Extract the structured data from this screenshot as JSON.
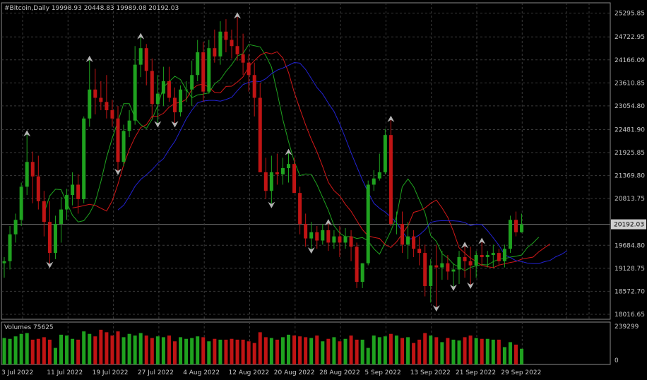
{
  "chart_data": {
    "type": "candlestick",
    "title": "#Bitcoin,Daily  19998.93 20448.83 19989.08 20192.03",
    "volume_label": "Volumes 75625",
    "last_price": "20192.03",
    "price_ticks": [
      "25295.85",
      "24722.95",
      "24166.09",
      "23610.85",
      "23054.80",
      "22481.90",
      "21925.85",
      "21369.80",
      "20813.75",
      "20192.03",
      "19684.80",
      "19128.75",
      "18572.70",
      "18016.65"
    ],
    "volume_ticks": [
      "239299",
      "0"
    ],
    "date_labels": [
      "3 Jul 2022",
      "11 Jul 2022",
      "19 Jul 2022",
      "27 Jul 2022",
      "4 Aug 2022",
      "12 Aug 2022",
      "20 Aug 2022",
      "28 Aug 2022",
      "5 Sep 2022",
      "13 Sep 2022",
      "21 Sep 2022",
      "29 Sep 2022"
    ],
    "grid": true,
    "colors": {
      "background": "#000000",
      "grid": "#3a3a3a",
      "bull": "#1fa21f",
      "bear": "#c01414",
      "ma_fast": "#1fa21f",
      "ma_mid": "#d01818",
      "ma_slow": "#2222d0",
      "fractal": "#b4b4b4",
      "text": "#c8c8c8"
    },
    "ohlc": [
      [
        19250,
        19400,
        18900,
        19300
      ],
      [
        19300,
        20150,
        19100,
        19950
      ],
      [
        19950,
        20450,
        19750,
        20300
      ],
      [
        20300,
        21200,
        20150,
        21100
      ],
      [
        21100,
        22400,
        20900,
        21700
      ],
      [
        21700,
        21950,
        20700,
        21350
      ],
      [
        21350,
        21850,
        20550,
        20750
      ],
      [
        20750,
        21000,
        19900,
        20250
      ],
      [
        20250,
        20750,
        19200,
        19500
      ],
      [
        19500,
        20400,
        19350,
        20200
      ],
      [
        20200,
        20850,
        19750,
        20550
      ],
      [
        20550,
        21050,
        20300,
        20900
      ],
      [
        20900,
        21450,
        20650,
        21150
      ],
      [
        21150,
        21400,
        20450,
        20800
      ],
      [
        20800,
        22800,
        20700,
        22750
      ],
      [
        22750,
        24200,
        22550,
        23450
      ],
      [
        23450,
        23950,
        22850,
        23250
      ],
      [
        23250,
        23650,
        22950,
        23150
      ],
      [
        23150,
        23800,
        22750,
        22950
      ],
      [
        22950,
        23200,
        22550,
        22750
      ],
      [
        22750,
        23050,
        21450,
        21700
      ],
      [
        21700,
        22600,
        21600,
        22450
      ],
      [
        22450,
        22950,
        22300,
        22700
      ],
      [
        22700,
        24500,
        22600,
        24050
      ],
      [
        24050,
        24750,
        23750,
        24450
      ],
      [
        24450,
        24550,
        23550,
        23900
      ],
      [
        23900,
        24200,
        22750,
        23100
      ],
      [
        23100,
        23800,
        22600,
        23350
      ],
      [
        23350,
        24000,
        23050,
        23650
      ],
      [
        23650,
        24000,
        23150,
        23250
      ],
      [
        23250,
        23500,
        22600,
        22900
      ],
      [
        22900,
        23550,
        22800,
        23450
      ],
      [
        23450,
        23650,
        23150,
        23450
      ],
      [
        23450,
        24150,
        23050,
        23800
      ],
      [
        23800,
        24650,
        23650,
        24350
      ],
      [
        24350,
        24600,
        23150,
        23400
      ],
      [
        23400,
        24650,
        23350,
        24450
      ],
      [
        24450,
        24900,
        24100,
        24250
      ],
      [
        24250,
        25100,
        24050,
        24850
      ],
      [
        24850,
        25150,
        24350,
        24650
      ],
      [
        24650,
        24900,
        24200,
        24500
      ],
      [
        24500,
        25250,
        24150,
        24300
      ],
      [
        24300,
        24800,
        23800,
        24100
      ],
      [
        24100,
        24300,
        23400,
        23800
      ],
      [
        23800,
        24100,
        22800,
        23250
      ],
      [
        23250,
        23600,
        21450,
        21450
      ],
      [
        21450,
        21800,
        20800,
        21000
      ],
      [
        21000,
        21850,
        20650,
        21450
      ],
      [
        21450,
        21900,
        21150,
        21400
      ],
      [
        21400,
        21800,
        21150,
        21550
      ],
      [
        21550,
        21950,
        21200,
        21650
      ],
      [
        21650,
        21800,
        20950,
        20950
      ],
      [
        20950,
        21100,
        19950,
        20200
      ],
      [
        20200,
        20450,
        19650,
        19850
      ],
      [
        19850,
        20250,
        19550,
        20000
      ],
      [
        20000,
        20150,
        19600,
        19800
      ],
      [
        19800,
        20200,
        19700,
        20050
      ],
      [
        20050,
        20250,
        19550,
        19750
      ],
      [
        19750,
        20050,
        19600,
        19900
      ],
      [
        19900,
        20150,
        19400,
        19750
      ],
      [
        19750,
        20100,
        19600,
        19900
      ],
      [
        19900,
        20050,
        19300,
        19650
      ],
      [
        19650,
        19750,
        18650,
        18800
      ],
      [
        18800,
        19250,
        18650,
        19250
      ],
      [
        19250,
        21250,
        19200,
        21150
      ],
      [
        21150,
        21500,
        21000,
        21300
      ],
      [
        21300,
        21900,
        21250,
        21450
      ],
      [
        21450,
        22500,
        21400,
        22350
      ],
      [
        22350,
        22750,
        20150,
        20200
      ],
      [
        20200,
        20500,
        19950,
        20200
      ],
      [
        20200,
        20500,
        19500,
        19700
      ],
      [
        19700,
        20250,
        19350,
        19900
      ],
      [
        19900,
        20050,
        19400,
        19600
      ],
      [
        19600,
        19900,
        19200,
        19500
      ],
      [
        19500,
        19700,
        18450,
        18700
      ],
      [
        18700,
        19350,
        18300,
        19200
      ],
      [
        19200,
        19700,
        18150,
        19150
      ],
      [
        19150,
        19550,
        18850,
        19250
      ],
      [
        19250,
        19450,
        18850,
        19050
      ],
      [
        19050,
        19250,
        18650,
        19100
      ],
      [
        19100,
        19550,
        18750,
        19400
      ],
      [
        19400,
        19700,
        18900,
        19300
      ],
      [
        19300,
        19650,
        18700,
        19200
      ],
      [
        19200,
        19550,
        18900,
        19450
      ],
      [
        19450,
        19800,
        19200,
        19400
      ],
      [
        19400,
        19550,
        19150,
        19450
      ],
      [
        19450,
        19700,
        19150,
        19500
      ],
      [
        19500,
        19600,
        19200,
        19300
      ],
      [
        19300,
        19700,
        19150,
        19600
      ],
      [
        19600,
        20400,
        19500,
        20300
      ],
      [
        20300,
        20500,
        19900,
        20000
      ],
      [
        19998.93,
        20448.83,
        19989.08,
        20192.03
      ]
    ],
    "volumes": [
      160000,
      155000,
      170000,
      185000,
      190000,
      150000,
      155000,
      165000,
      150000,
      100000,
      180000,
      175000,
      155000,
      150000,
      200000,
      185000,
      170000,
      210000,
      195000,
      175000,
      200000,
      165000,
      185000,
      175000,
      190000,
      175000,
      160000,
      170000,
      165000,
      175000,
      140000,
      165000,
      155000,
      160000,
      170000,
      165000,
      140000,
      155000,
      150000,
      150000,
      155000,
      150000,
      150000,
      140000,
      130000,
      195000,
      165000,
      160000,
      150000,
      165000,
      180000,
      175000,
      170000,
      165000,
      160000,
      175000,
      140000,
      155000,
      165000,
      140000,
      155000,
      175000,
      150000,
      150000,
      100000,
      175000,
      165000,
      170000,
      185000,
      175000,
      160000,
      165000,
      130000,
      150000,
      190000,
      175000,
      165000,
      135000,
      160000,
      150000,
      145000,
      165000,
      175000,
      160000,
      155000,
      155000,
      150000,
      150000,
      105000,
      135000,
      120000,
      95000
    ],
    "ma_fast": [
      null,
      null,
      null,
      null,
      null,
      null,
      null,
      null,
      null,
      null,
      null,
      null,
      null,
      null,
      null,
      null,
      null,
      null,
      null,
      null,
      null,
      null,
      null,
      null,
      null,
      null,
      null,
      null,
      null,
      null,
      null,
      null,
      null,
      null,
      null,
      null,
      null,
      null,
      null,
      null,
      null,
      null,
      null,
      null,
      null,
      null,
      null,
      null,
      null,
      null,
      null,
      null,
      null,
      null,
      null,
      null,
      null,
      null,
      null,
      null,
      null,
      null,
      null,
      null,
      null,
      null,
      null,
      null,
      null,
      null,
      null,
      null,
      null,
      null,
      null,
      null,
      null,
      null,
      null,
      null,
      null,
      null,
      null,
      null,
      null,
      null,
      null,
      null,
      null,
      null,
      null,
      null
    ]
  }
}
